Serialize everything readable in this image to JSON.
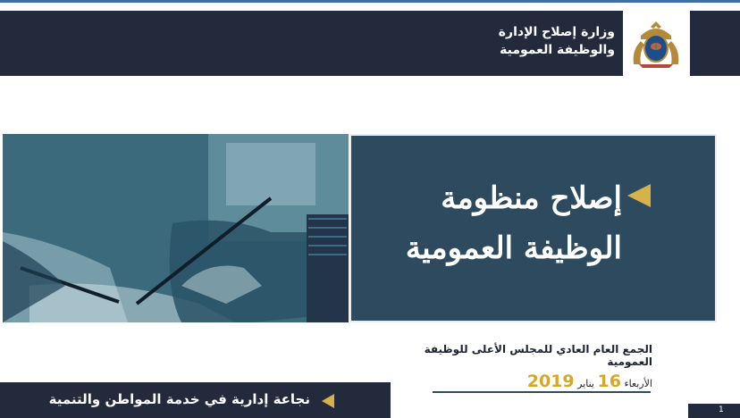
{
  "header": {
    "ministry_line1": "وزارة إصلاح الإدارة",
    "ministry_line2": "والوظيفة العمومية",
    "emblem_icon": "morocco-coat-of-arms-icon"
  },
  "hero": {
    "title_line1": "إصلاح منظومة",
    "title_line2": "الوظيفة العمومية",
    "bullet_icon": "gold-triangle-icon",
    "photo": "hands-signing-document-image"
  },
  "event": {
    "line1": "الجمع العام العادي للمجلس الأعلى للوظيفة العمومية",
    "weekday": "الأربعاء",
    "day": "16",
    "month": "يناير",
    "year": "2019"
  },
  "footer": {
    "slogan": "نجاعة إدارية في خدمة المواطن والتنمية",
    "bullet_icon": "gold-triangle-icon"
  },
  "slide": {
    "page_number": "1"
  },
  "colors": {
    "navy": "#232a3b",
    "panel": "#2d4a5f",
    "gold": "#d6b24a"
  }
}
